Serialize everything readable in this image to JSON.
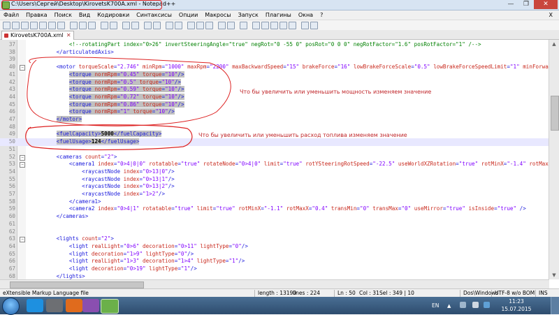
{
  "window": {
    "title": "C:\\Users\\Сергей\\Desktop\\KirovetsK700A.xml - Notepad++",
    "buttons": [
      "—",
      "❐",
      "✕"
    ]
  },
  "menu": [
    "Файл",
    "Правка",
    "Поиск",
    "Вид",
    "Кодировки",
    "Синтаксисы",
    "Опции",
    "Макросы",
    "Запуск",
    "Плагины",
    "Окна",
    "?"
  ],
  "menu_close": "X",
  "tab": {
    "label": "KirovetsK700A.xml"
  },
  "lines": [
    {
      "n": "37",
      "parts": [
        [
          "cmt",
          "            <!--rotatingPart index=\"0>26\" invertSteeringAngle=\"true\" negRot=\"0 -55 0\" posRot=\"0 0 0\" negRotFactor=\"1.6\" posRotFactor=\"1\" /-->"
        ]
      ]
    },
    {
      "n": "38",
      "parts": [
        [
          "tag",
          "        </articulatedAxis>"
        ]
      ]
    },
    {
      "n": "39",
      "parts": []
    },
    {
      "n": "40",
      "parts": [
        [
          "tag",
          "        <motor "
        ],
        [
          "attr",
          "torqueScale"
        ],
        [
          "tag",
          "="
        ],
        [
          "val",
          "\"2.746\""
        ],
        [
          "attr",
          " minRpm"
        ],
        [
          "tag",
          "="
        ],
        [
          "val",
          "\"1000\""
        ],
        [
          "attr",
          " maxRpm"
        ],
        [
          "tag",
          "="
        ],
        [
          "val",
          "\"2200\""
        ],
        [
          "attr",
          " maxBackwardSpeed"
        ],
        [
          "tag",
          "="
        ],
        [
          "val",
          "\"15\""
        ],
        [
          "attr",
          " brakeForce"
        ],
        [
          "tag",
          "="
        ],
        [
          "val",
          "\"16\""
        ],
        [
          "attr",
          " lowBrakeForceScale"
        ],
        [
          "tag",
          "="
        ],
        [
          "val",
          "\"0.5\""
        ],
        [
          "attr",
          " lowBrakeForceSpeedLimit"
        ],
        [
          "tag",
          "="
        ],
        [
          "val",
          "\"1\""
        ],
        [
          "attr",
          " minForward"
        ]
      ]
    },
    {
      "n": "41",
      "sel": true,
      "parts": [
        [
          "tag",
          "            <torque "
        ],
        [
          "attr",
          "normRpm"
        ],
        [
          "tag",
          "="
        ],
        [
          "val",
          "\"0.45\""
        ],
        [
          "attr",
          " torque"
        ],
        [
          "tag",
          "="
        ],
        [
          "val",
          "\"10\""
        ],
        [
          "tag",
          "/>"
        ]
      ]
    },
    {
      "n": "42",
      "sel": true,
      "parts": [
        [
          "tag",
          "            <torque "
        ],
        [
          "attr",
          "normRpm"
        ],
        [
          "tag",
          "="
        ],
        [
          "val",
          "\"0.5\""
        ],
        [
          "attr",
          " torque"
        ],
        [
          "tag",
          "="
        ],
        [
          "val",
          "\"10\""
        ],
        [
          "tag",
          "/>"
        ]
      ]
    },
    {
      "n": "43",
      "sel": true,
      "parts": [
        [
          "tag",
          "            <torque "
        ],
        [
          "attr",
          "normRpm"
        ],
        [
          "tag",
          "="
        ],
        [
          "val",
          "\"0.59\""
        ],
        [
          "attr",
          " torque"
        ],
        [
          "tag",
          "="
        ],
        [
          "val",
          "\"10\""
        ],
        [
          "tag",
          "/>"
        ]
      ]
    },
    {
      "n": "44",
      "sel": true,
      "parts": [
        [
          "tag",
          "            <torque "
        ],
        [
          "attr",
          "normRpm"
        ],
        [
          "tag",
          "="
        ],
        [
          "val",
          "\"0.72\""
        ],
        [
          "attr",
          " torque"
        ],
        [
          "tag",
          "="
        ],
        [
          "val",
          "\"10\""
        ],
        [
          "tag",
          "/>"
        ]
      ]
    },
    {
      "n": "45",
      "sel": true,
      "parts": [
        [
          "tag",
          "            <torque "
        ],
        [
          "attr",
          "normRpm"
        ],
        [
          "tag",
          "="
        ],
        [
          "val",
          "\"0.86\""
        ],
        [
          "attr",
          " torque"
        ],
        [
          "tag",
          "="
        ],
        [
          "val",
          "\"10\""
        ],
        [
          "tag",
          "/>"
        ]
      ]
    },
    {
      "n": "46",
      "sel": true,
      "parts": [
        [
          "tag",
          "            <torque "
        ],
        [
          "attr",
          "normRpm"
        ],
        [
          "tag",
          "="
        ],
        [
          "val",
          "\"1\""
        ],
        [
          "attr",
          " torque"
        ],
        [
          "tag",
          "="
        ],
        [
          "val",
          "\"10\""
        ],
        [
          "tag",
          "/>"
        ]
      ]
    },
    {
      "n": "47",
      "sel": true,
      "parts": [
        [
          "tag",
          "        </motor>"
        ]
      ]
    },
    {
      "n": "48",
      "parts": []
    },
    {
      "n": "49",
      "sel": true,
      "parts": [
        [
          "tag",
          "        <fuelCapacity>"
        ],
        [
          "txt",
          "5000"
        ],
        [
          "tag",
          "</fuelCapacity>"
        ]
      ]
    },
    {
      "n": "50",
      "sel": true,
      "current": true,
      "parts": [
        [
          "tag",
          "        <fuelUsage>"
        ],
        [
          "txt",
          "124"
        ],
        [
          "tag",
          "</fuelUsage>"
        ]
      ]
    },
    {
      "n": "51",
      "parts": []
    },
    {
      "n": "52",
      "parts": [
        [
          "tag",
          "        <cameras "
        ],
        [
          "attr",
          "count"
        ],
        [
          "tag",
          "="
        ],
        [
          "val",
          "\"2\""
        ],
        [
          "tag",
          ">"
        ]
      ]
    },
    {
      "n": "53",
      "parts": [
        [
          "tag",
          "            <camera1 "
        ],
        [
          "attr",
          "index"
        ],
        [
          "tag",
          "="
        ],
        [
          "val",
          "\"0>4|0|0\""
        ],
        [
          "attr",
          " rotatable"
        ],
        [
          "tag",
          "="
        ],
        [
          "val",
          "\"true\""
        ],
        [
          "attr",
          " rotateNode"
        ],
        [
          "tag",
          "="
        ],
        [
          "val",
          "\"0>4|0\""
        ],
        [
          "attr",
          " limit"
        ],
        [
          "tag",
          "="
        ],
        [
          "val",
          "\"true\""
        ],
        [
          "attr",
          " rotYSteeringRotSpeed"
        ],
        [
          "tag",
          "="
        ],
        [
          "val",
          "\"-22.5\""
        ],
        [
          "attr",
          " useWorldXZRotation"
        ],
        [
          "tag",
          "="
        ],
        [
          "val",
          "\"true\""
        ],
        [
          "attr",
          " rotMinX"
        ],
        [
          "tag",
          "="
        ],
        [
          "val",
          "\"-1.4\""
        ],
        [
          "attr",
          " rotMaxX"
        ],
        [
          "tag",
          "="
        ]
      ]
    },
    {
      "n": "54",
      "parts": [
        [
          "tag",
          "                <raycastNode "
        ],
        [
          "attr",
          "index"
        ],
        [
          "tag",
          "="
        ],
        [
          "val",
          "\"0>13|0\""
        ],
        [
          "tag",
          "/>"
        ]
      ]
    },
    {
      "n": "55",
      "parts": [
        [
          "tag",
          "                <raycastNode "
        ],
        [
          "attr",
          "index"
        ],
        [
          "tag",
          "="
        ],
        [
          "val",
          "\"0>13|1\""
        ],
        [
          "tag",
          "/>"
        ]
      ]
    },
    {
      "n": "56",
      "parts": [
        [
          "tag",
          "                <raycastNode "
        ],
        [
          "attr",
          "index"
        ],
        [
          "tag",
          "="
        ],
        [
          "val",
          "\"0>13|2\""
        ],
        [
          "tag",
          "/>"
        ]
      ]
    },
    {
      "n": "57",
      "parts": [
        [
          "tag",
          "                <raycastNode "
        ],
        [
          "attr",
          "index"
        ],
        [
          "tag",
          "="
        ],
        [
          "val",
          "\"1>2\""
        ],
        [
          "tag",
          "/>"
        ]
      ]
    },
    {
      "n": "58",
      "parts": [
        [
          "tag",
          "            </camera1>"
        ]
      ]
    },
    {
      "n": "59",
      "parts": [
        [
          "tag",
          "            <camera2 "
        ],
        [
          "attr",
          "index"
        ],
        [
          "tag",
          "="
        ],
        [
          "val",
          "\"0>4|1\""
        ],
        [
          "attr",
          " rotatable"
        ],
        [
          "tag",
          "="
        ],
        [
          "val",
          "\"true\""
        ],
        [
          "attr",
          " limit"
        ],
        [
          "tag",
          "="
        ],
        [
          "val",
          "\"true\""
        ],
        [
          "attr",
          " rotMinX"
        ],
        [
          "tag",
          "="
        ],
        [
          "val",
          "\"-1.1\""
        ],
        [
          "attr",
          " rotMaxX"
        ],
        [
          "tag",
          "="
        ],
        [
          "val",
          "\"0.4\""
        ],
        [
          "attr",
          " transMin"
        ],
        [
          "tag",
          "="
        ],
        [
          "val",
          "\"0\""
        ],
        [
          "attr",
          " transMax"
        ],
        [
          "tag",
          "="
        ],
        [
          "val",
          "\"0\""
        ],
        [
          "attr",
          " useMirror"
        ],
        [
          "tag",
          "="
        ],
        [
          "val",
          "\"true\""
        ],
        [
          "attr",
          " isInside"
        ],
        [
          "tag",
          "="
        ],
        [
          "val",
          "\"true\""
        ],
        [
          "tag",
          " />"
        ]
      ]
    },
    {
      "n": "60",
      "parts": [
        [
          "tag",
          "        </cameras>"
        ]
      ]
    },
    {
      "n": "61",
      "parts": []
    },
    {
      "n": "62",
      "parts": []
    },
    {
      "n": "63",
      "parts": [
        [
          "tag",
          "        <lights "
        ],
        [
          "attr",
          "count"
        ],
        [
          "tag",
          "="
        ],
        [
          "val",
          "\"2\""
        ],
        [
          "tag",
          ">"
        ]
      ]
    },
    {
      "n": "64",
      "parts": [
        [
          "tag",
          "            <light "
        ],
        [
          "attr",
          "realLight"
        ],
        [
          "tag",
          "="
        ],
        [
          "val",
          "\"0>6\""
        ],
        [
          "attr",
          " decoration"
        ],
        [
          "tag",
          "="
        ],
        [
          "val",
          "\"0>11\""
        ],
        [
          "attr",
          " lightType"
        ],
        [
          "tag",
          "="
        ],
        [
          "val",
          "\"0\""
        ],
        [
          "tag",
          "/>"
        ]
      ]
    },
    {
      "n": "65",
      "parts": [
        [
          "tag",
          "            <light "
        ],
        [
          "attr",
          "decoration"
        ],
        [
          "tag",
          "="
        ],
        [
          "val",
          "\"1>9\""
        ],
        [
          "attr",
          " lightType"
        ],
        [
          "tag",
          "="
        ],
        [
          "val",
          "\"0\""
        ],
        [
          "tag",
          "/>"
        ]
      ]
    },
    {
      "n": "66",
      "parts": [
        [
          "tag",
          "            <light "
        ],
        [
          "attr",
          "realLight"
        ],
        [
          "tag",
          "="
        ],
        [
          "val",
          "\"1>3\""
        ],
        [
          "attr",
          " decoration"
        ],
        [
          "tag",
          "="
        ],
        [
          "val",
          "\"1>4\""
        ],
        [
          "attr",
          " lightType"
        ],
        [
          "tag",
          "="
        ],
        [
          "val",
          "\"1\""
        ],
        [
          "tag",
          "/>"
        ]
      ]
    },
    {
      "n": "67",
      "parts": [
        [
          "tag",
          "            <light "
        ],
        [
          "attr",
          "decoration"
        ],
        [
          "tag",
          "="
        ],
        [
          "val",
          "\"0>19\""
        ],
        [
          "attr",
          " lightType"
        ],
        [
          "tag",
          "="
        ],
        [
          "val",
          "\"1\""
        ],
        [
          "tag",
          "/>"
        ]
      ]
    },
    {
      "n": "68",
      "parts": [
        [
          "tag",
          "        </lights>"
        ]
      ]
    }
  ],
  "annotations": {
    "power": "Что бы увеличить или уменьшить мощность изменяем значение",
    "fuel": "Что бы увеличить или уменьшить расход топлива изменяем значение"
  },
  "status": {
    "lang": "eXtensible Markup Language file",
    "length": "length : 13190",
    "lines": "lines : 224",
    "ln": "Ln : 50",
    "col": "Col : 31",
    "sel": "Sel : 349 | 10",
    "eol": "Dos\\Windows",
    "enc": "UTF-8 w/o BOM",
    "ins": "INS"
  },
  "tray": {
    "lang": "EN",
    "time": "11:23",
    "date": "15.07.2015"
  },
  "colors": {
    "annotation": "#d22020",
    "selection": "#c0c0c0",
    "tag": "#1a1adc",
    "attr": "#c8281c",
    "value": "#8000ff"
  }
}
